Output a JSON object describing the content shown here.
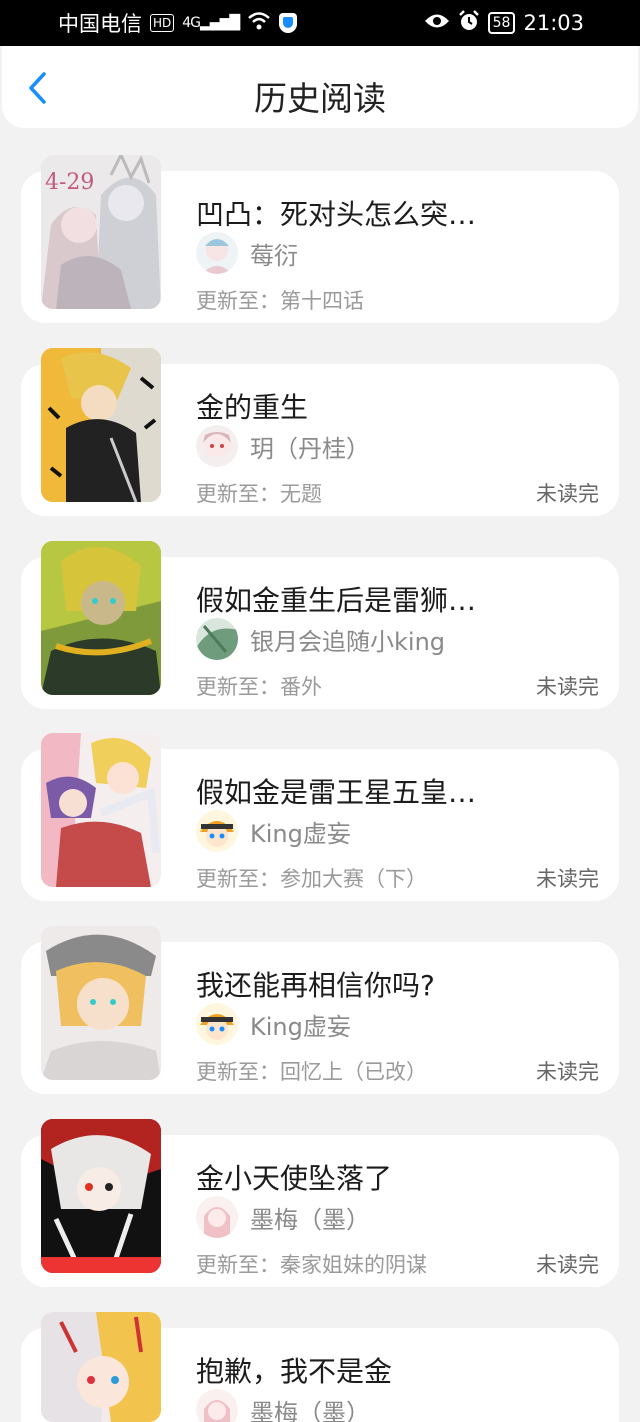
{
  "status_bar": {
    "carrier": "中国电信",
    "hd_badge": "HD",
    "network": "4G",
    "battery": "58",
    "time": "21:03"
  },
  "header": {
    "title": "历史阅读",
    "back_icon": "chevron-left-icon"
  },
  "labels": {
    "update_prefix": "更新至：",
    "unread": "未读完"
  },
  "colors": {
    "accent": "#1a8cff",
    "background": "#f2f2f2"
  },
  "items": [
    {
      "title": "凹凸：死对头怎么突…",
      "author": "莓衍",
      "update": "第十四话",
      "status": "",
      "cover_text": "4-29"
    },
    {
      "title": "金的重生",
      "author": "玥（丹桂）",
      "update": "无题",
      "status": "未读完"
    },
    {
      "title": "假如金重生后是雷狮…",
      "author": "银月会追随小king",
      "update": "番外",
      "status": "未读完"
    },
    {
      "title": "假如金是雷王星五皇…",
      "author": "King虚妄",
      "update": "参加大赛（下）",
      "status": "未读完"
    },
    {
      "title": "我还能再相信你吗?",
      "author": "King虚妄",
      "update": "回忆上（已改）",
      "status": "未读完"
    },
    {
      "title": "金小天使坠落了",
      "author": "墨梅（墨）",
      "update": "秦家姐妹的阴谋",
      "status": "未读完"
    },
    {
      "title": "抱歉，我不是金",
      "author": "墨梅（墨）",
      "update": "",
      "status": ""
    }
  ]
}
